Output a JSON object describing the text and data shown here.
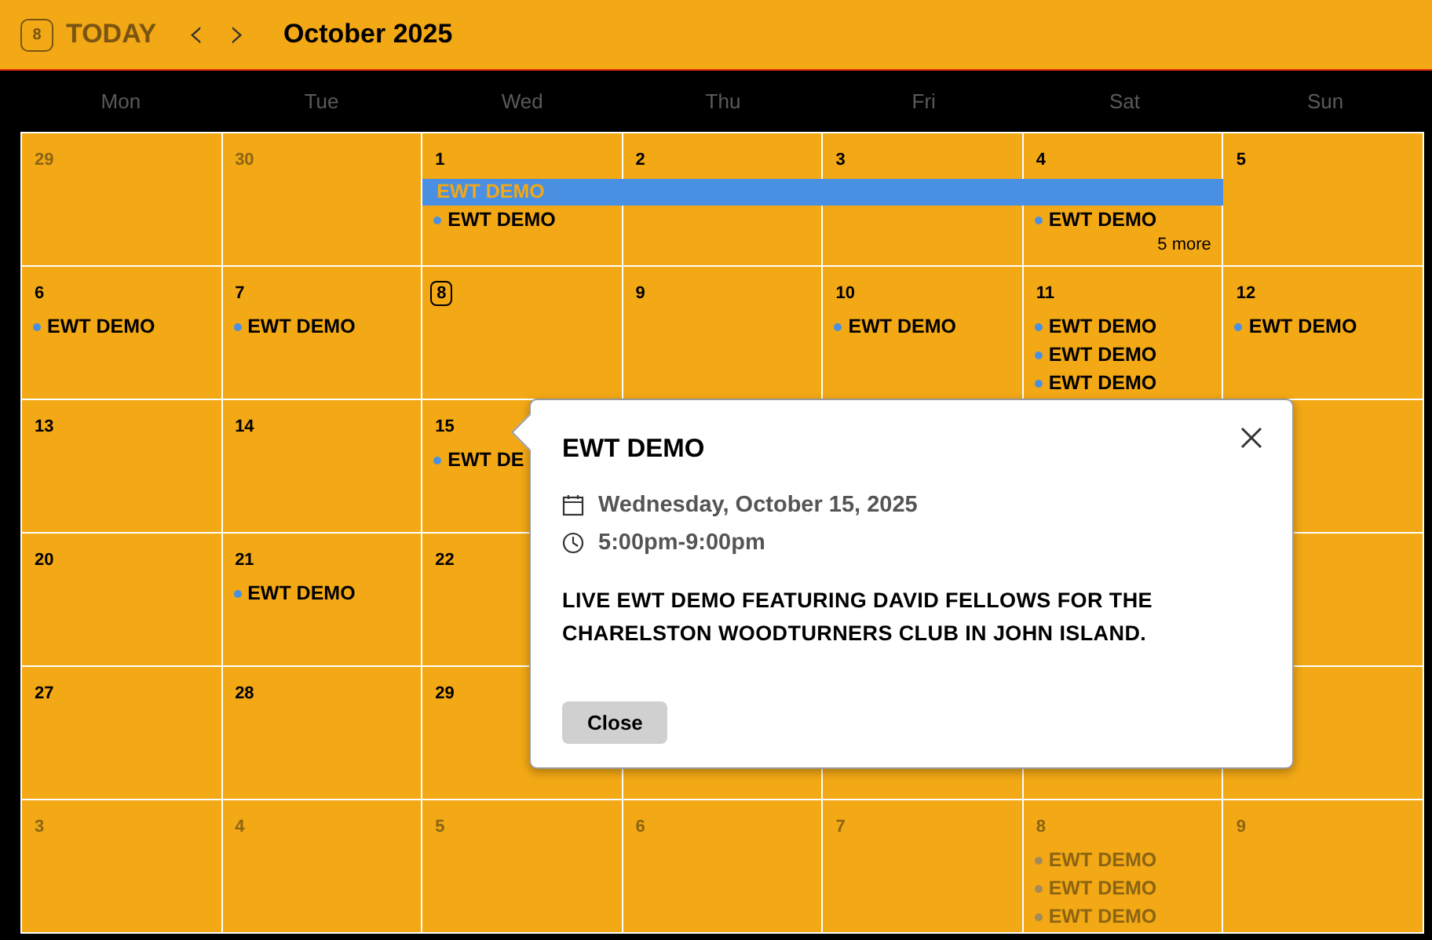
{
  "toolbar": {
    "today_badge": "8",
    "today_label": "TODAY",
    "prev": "‹",
    "next": "›",
    "title": "October 2025"
  },
  "weekdays": [
    "Mon",
    "Tue",
    "Wed",
    "Thu",
    "Fri",
    "Sat",
    "Sun"
  ],
  "weeks": [
    {
      "banner": {
        "label": "EWT DEMO"
      },
      "days": [
        {
          "date": "29",
          "muted": true,
          "today": false,
          "in_banner": false
        },
        {
          "date": "30",
          "muted": true,
          "today": false,
          "in_banner": false
        },
        {
          "date": "1",
          "muted": false,
          "today": false,
          "in_banner": true,
          "events": [
            "EWT DEMO"
          ]
        },
        {
          "date": "2",
          "muted": false,
          "today": false,
          "in_banner": true
        },
        {
          "date": "3",
          "muted": false,
          "today": false,
          "in_banner": true
        },
        {
          "date": "4",
          "muted": false,
          "today": false,
          "in_banner": true,
          "events": [
            "EWT DEMO"
          ],
          "more": "5 more"
        },
        {
          "date": "5",
          "muted": false,
          "today": false,
          "in_banner": false
        }
      ]
    },
    {
      "days": [
        {
          "date": "6",
          "muted": false,
          "today": false,
          "events": [
            "EWT DEMO"
          ]
        },
        {
          "date": "7",
          "muted": false,
          "today": false,
          "events": [
            "EWT DEMO"
          ]
        },
        {
          "date": "8",
          "muted": false,
          "today": true
        },
        {
          "date": "9",
          "muted": false,
          "today": false
        },
        {
          "date": "10",
          "muted": false,
          "today": false,
          "events": [
            "EWT DEMO"
          ]
        },
        {
          "date": "11",
          "muted": false,
          "today": false,
          "events": [
            "EWT DEMO",
            "EWT DEMO",
            "EWT DEMO"
          ]
        },
        {
          "date": "12",
          "muted": false,
          "today": false,
          "events": [
            "EWT DEMO"
          ]
        }
      ]
    },
    {
      "days": [
        {
          "date": "13",
          "muted": false,
          "today": false
        },
        {
          "date": "14",
          "muted": false,
          "today": false
        },
        {
          "date": "15",
          "muted": false,
          "today": false,
          "events": [
            "EWT DE"
          ]
        }
      ]
    },
    {
      "days": [
        {
          "date": "20",
          "muted": false,
          "today": false
        },
        {
          "date": "21",
          "muted": false,
          "today": false,
          "events": [
            "EWT DEMO"
          ]
        },
        {
          "date": "22",
          "muted": false,
          "today": false
        }
      ]
    },
    {
      "days": [
        {
          "date": "27",
          "muted": false,
          "today": false
        },
        {
          "date": "28",
          "muted": false,
          "today": false
        },
        {
          "date": "29",
          "muted": false,
          "today": false
        }
      ]
    },
    {
      "days": [
        {
          "date": "3",
          "muted": true,
          "today": false
        },
        {
          "date": "4",
          "muted": true,
          "today": false
        },
        {
          "date": "5",
          "muted": true,
          "today": false
        },
        {
          "date": "6",
          "muted": true,
          "today": false
        },
        {
          "date": "7",
          "muted": true,
          "today": false
        },
        {
          "date": "8",
          "muted": true,
          "today": false,
          "events": [
            "EWT DEMO",
            "EWT DEMO",
            "EWT DEMO"
          ]
        },
        {
          "date": "9",
          "muted": true,
          "today": false
        }
      ]
    }
  ],
  "popover": {
    "title": "EWT DEMO",
    "date": "Wednesday, October 15, 2025",
    "time": "5:00pm-9:00pm",
    "description": "LIVE EWT DEMO FEATURING DAVID FELLOWS FOR THE CHARELSTON WOODTURNERS CLUB IN JOHN ISLAND.",
    "button": "Close"
  }
}
